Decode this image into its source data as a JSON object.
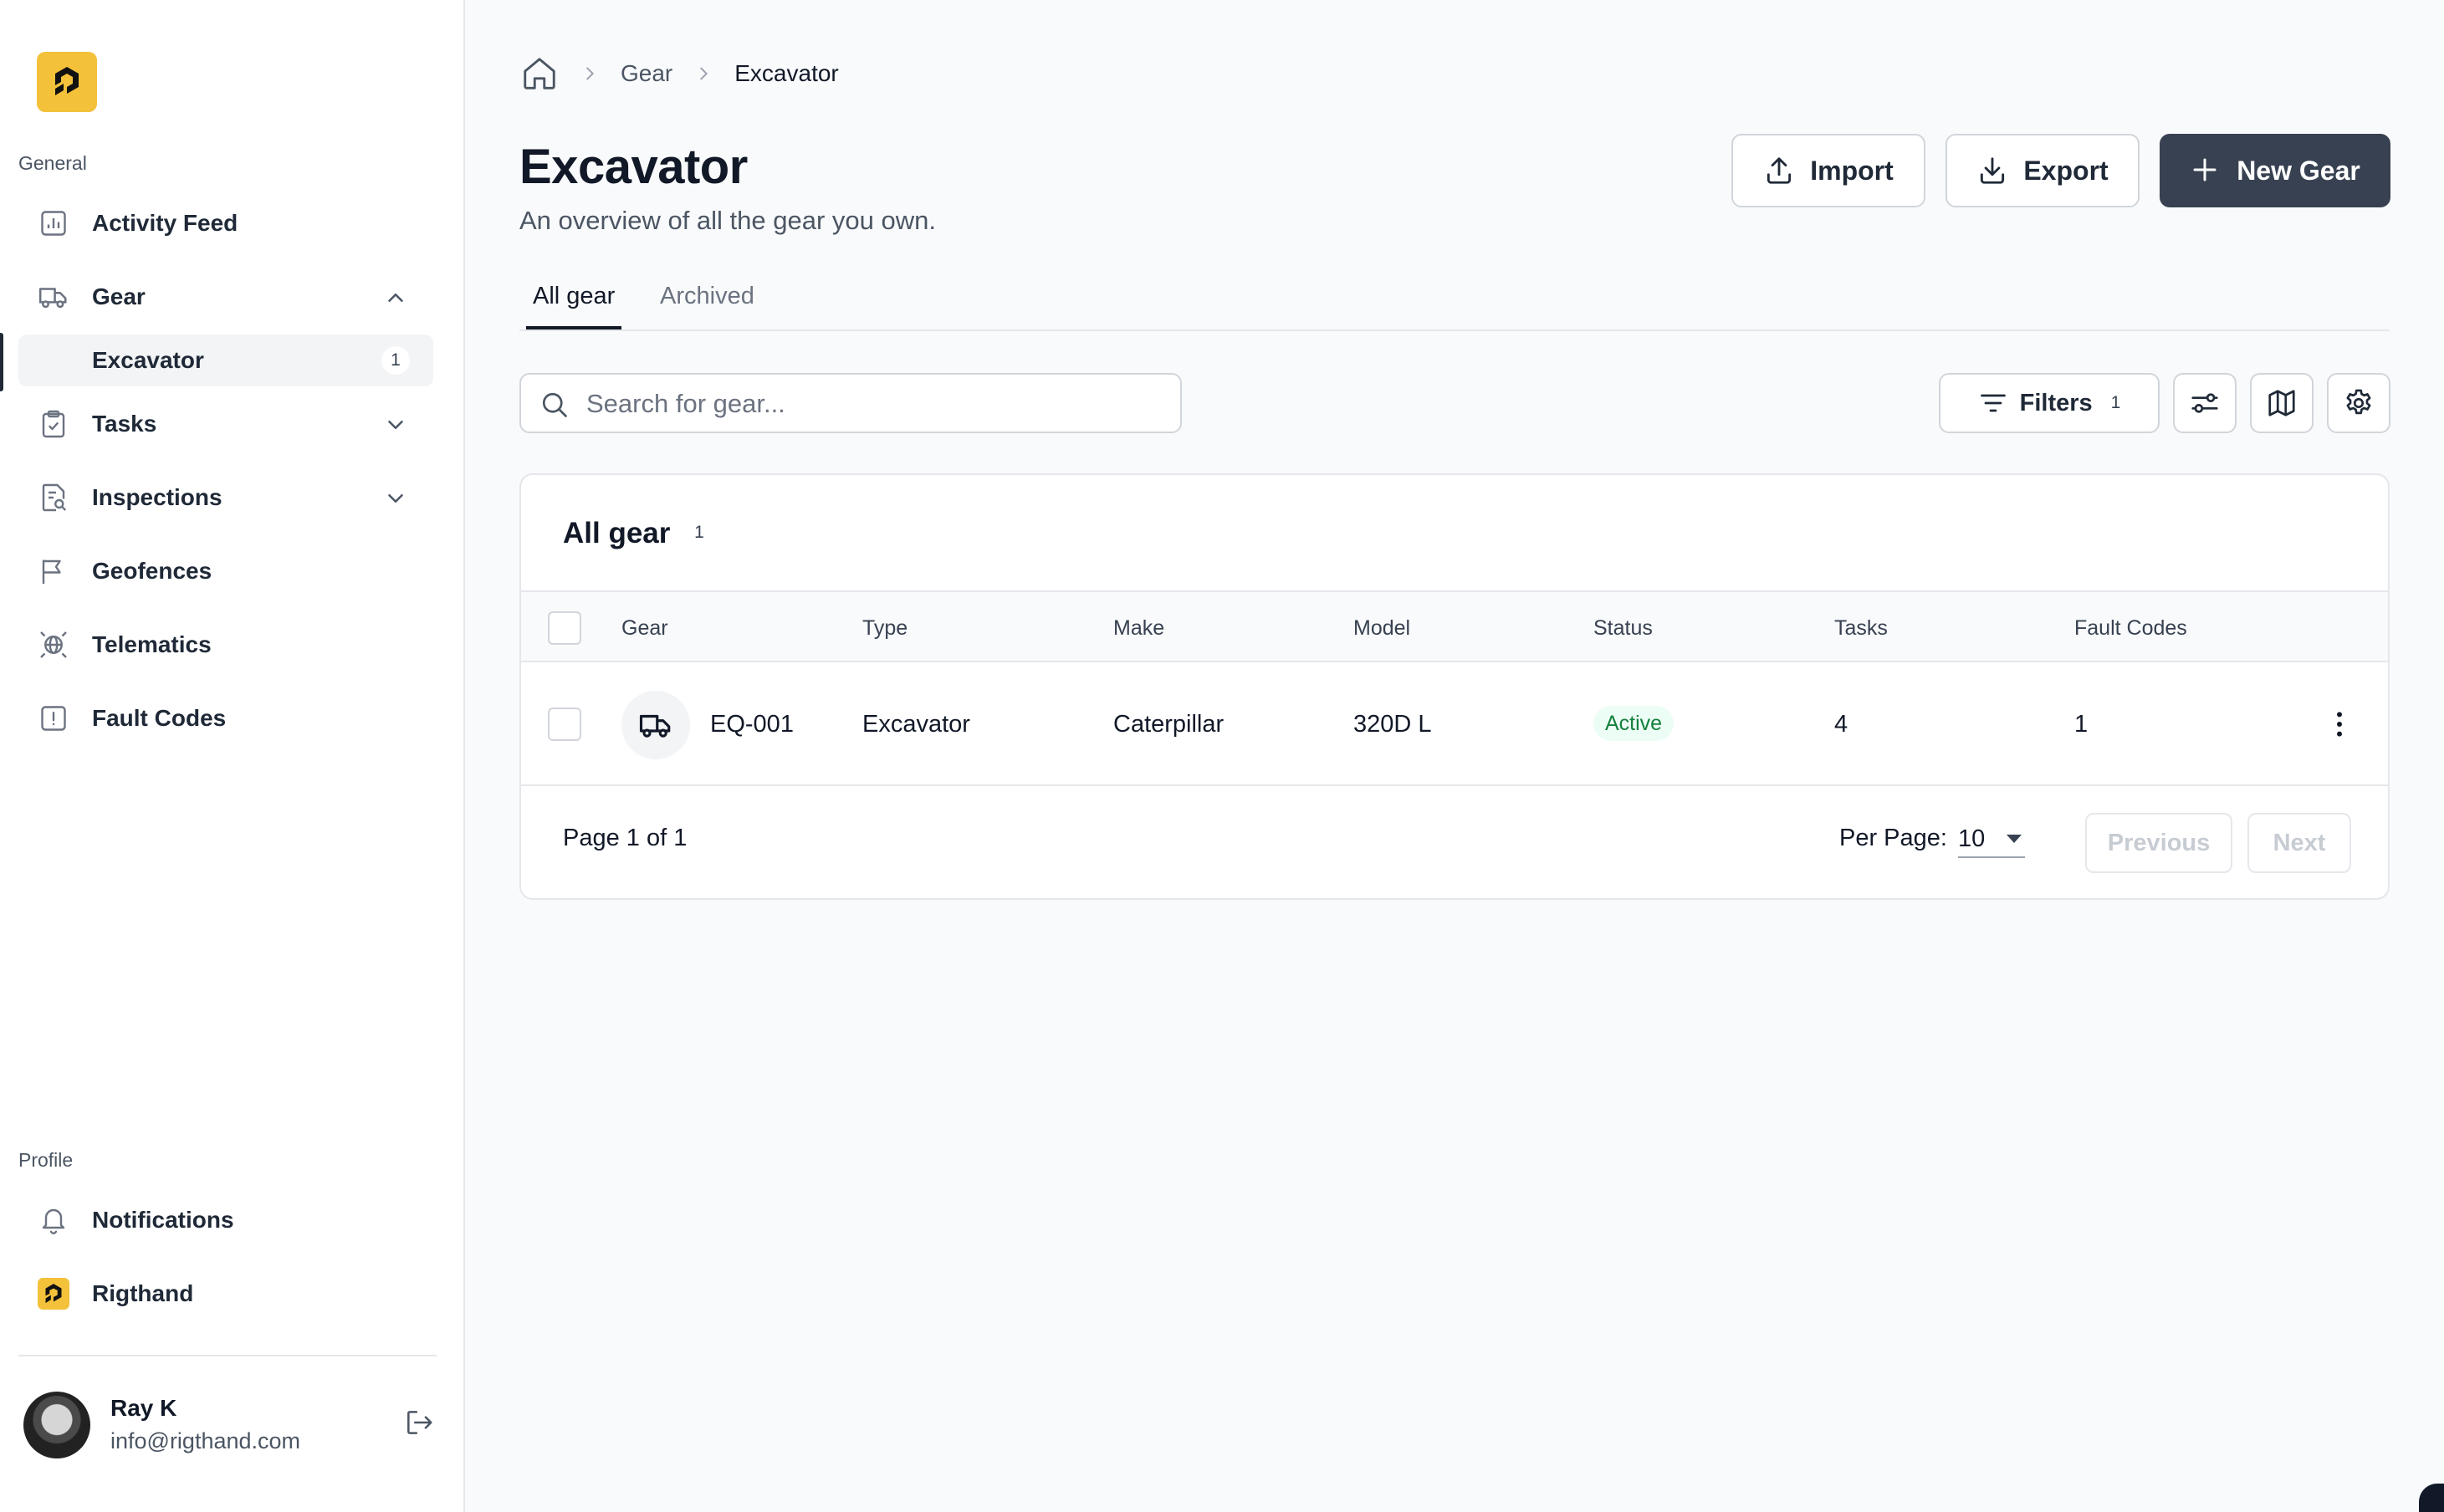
{
  "sidebar": {
    "general_label": "General",
    "profile_label": "Profile",
    "items": [
      {
        "label": "Activity Feed",
        "icon": "chart-icon"
      },
      {
        "label": "Gear",
        "icon": "truck-icon",
        "expanded": true
      },
      {
        "label": "Tasks",
        "icon": "clipboard-check-icon"
      },
      {
        "label": "Inspections",
        "icon": "document-search-icon"
      },
      {
        "label": "Geofences",
        "icon": "flag-icon"
      },
      {
        "label": "Telematics",
        "icon": "globe-icon"
      },
      {
        "label": "Fault Codes",
        "icon": "exclamation-square-icon"
      }
    ],
    "sub_item": {
      "label": "Excavator",
      "count": "1"
    },
    "profile_items": [
      {
        "label": "Notifications",
        "icon": "bell-icon"
      },
      {
        "label": "Rigthand",
        "icon": "org-logo-icon"
      }
    ],
    "user": {
      "name": "Ray K",
      "email": "info@rigthand.com"
    }
  },
  "breadcrumb": {
    "items": [
      "Gear",
      "Excavator"
    ]
  },
  "header": {
    "title": "Excavator",
    "subtitle": "An overview of all the gear you own.",
    "import_label": "Import",
    "export_label": "Export",
    "new_label": "New Gear"
  },
  "tabs": [
    {
      "label": "All gear",
      "active": true
    },
    {
      "label": "Archived",
      "active": false
    }
  ],
  "toolbar": {
    "search_placeholder": "Search for gear...",
    "filters_label": "Filters",
    "filters_count": "1"
  },
  "table": {
    "title": "All gear",
    "count": "1",
    "columns": [
      "Gear",
      "Type",
      "Make",
      "Model",
      "Status",
      "Tasks",
      "Fault Codes"
    ],
    "rows": [
      {
        "gear": "EQ-001",
        "type": "Excavator",
        "make": "Caterpillar",
        "model": "320D L",
        "status": "Active",
        "tasks": "4",
        "fault_codes": "1"
      }
    ]
  },
  "pagination": {
    "page_text": "Page 1 of 1",
    "per_page_label": "Per Page:",
    "per_page_value": "10",
    "previous_label": "Previous",
    "next_label": "Next"
  },
  "colors": {
    "accent": "#f3c13a",
    "primary_button": "#374151",
    "status_active": "#15803d"
  }
}
